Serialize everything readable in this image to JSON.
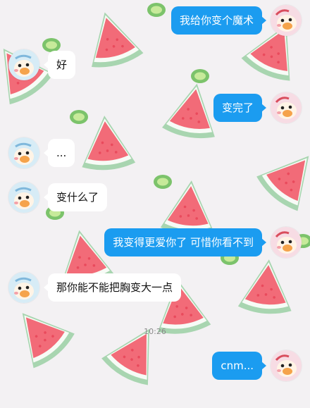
{
  "colors": {
    "outgoing_bubble": "#1b9cf0",
    "incoming_bubble": "#ffffff",
    "background": "#f3f1f3"
  },
  "messages": [
    {
      "side": "right",
      "text": "我给你变个魔术"
    },
    {
      "side": "left",
      "text": "好"
    },
    {
      "side": "right",
      "text": "变完了"
    },
    {
      "side": "left",
      "text": "..."
    },
    {
      "side": "left",
      "text": "变什么了"
    },
    {
      "side": "right",
      "text": "我变得更爱你了 可惜你看不到"
    },
    {
      "side": "left",
      "text": "那你能不能把胸变大一点"
    },
    {
      "side": "right",
      "text": "cnm..."
    }
  ],
  "timestamp": "10:26",
  "icons": {
    "left_avatar": "cartoon-avatar-blue-icon",
    "right_avatar": "cartoon-avatar-pink-icon"
  }
}
